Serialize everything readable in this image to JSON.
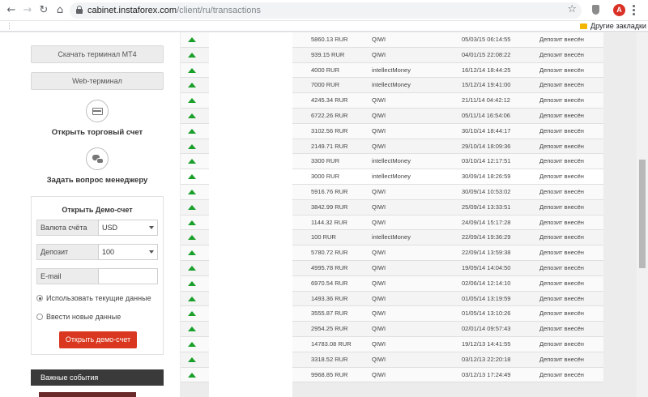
{
  "browser": {
    "url_host": "cabinet.instaforex.com",
    "url_path": "/client/ru/transactions",
    "avatar_letter": "A",
    "bookmarks_label": "Другие закладки"
  },
  "sidebar": {
    "download_terminal": "Скачать терминал MT4",
    "web_terminal": "Web-терминал",
    "open_account": "Открыть торговый счет",
    "ask_manager": "Задать вопрос менеджеру"
  },
  "demo": {
    "title": "Открыть Демо-счет",
    "currency_label": "Валюта счёта",
    "currency_value": "USD",
    "deposit_label": "Депозит",
    "deposit_value": "100",
    "email_label": "E-mail",
    "email_value": "",
    "use_current": "Использовать текущие данные",
    "enter_new": "Ввести новые данные",
    "submit": "Открыть демо-счет"
  },
  "events": {
    "title": "Важные события"
  },
  "transactions": [
    {
      "amount": "5860.13 RUR",
      "system": "QIWI",
      "date": "05/03/15 06:14:55",
      "status": "Депозит внесён"
    },
    {
      "amount": "939.15 RUR",
      "system": "QIWI",
      "date": "04/01/15 22:08:22",
      "status": "Депозит внесён"
    },
    {
      "amount": "4000 RUR",
      "system": "intellectMoney",
      "date": "16/12/14 18:44:25",
      "status": "Депозит внесён"
    },
    {
      "amount": "7000 RUR",
      "system": "intellectMoney",
      "date": "15/12/14 19:41:00",
      "status": "Депозит внесён"
    },
    {
      "amount": "4245.34 RUR",
      "system": "QIWI",
      "date": "21/11/14 04:42:12",
      "status": "Депозит внесён"
    },
    {
      "amount": "6722.26 RUR",
      "system": "QIWI",
      "date": "05/11/14 16:54:06",
      "status": "Депозит внесён"
    },
    {
      "amount": "3102.56 RUR",
      "system": "QIWI",
      "date": "30/10/14 18:44:17",
      "status": "Депозит внесён"
    },
    {
      "amount": "2149.71 RUR",
      "system": "QIWI",
      "date": "29/10/14 18:09:36",
      "status": "Депозит внесён"
    },
    {
      "amount": "3300 RUR",
      "system": "intellectMoney",
      "date": "03/10/14 12:17:51",
      "status": "Депозит внесён"
    },
    {
      "amount": "3000 RUR",
      "system": "intellectMoney",
      "date": "30/09/14 18:26:59",
      "status": "Депозит внесён"
    },
    {
      "amount": "5916.76 RUR",
      "system": "QIWI",
      "date": "30/09/14 10:53:02",
      "status": "Депозит внесён"
    },
    {
      "amount": "3842.99 RUR",
      "system": "QIWI",
      "date": "25/09/14 13:33:51",
      "status": "Депозит внесён"
    },
    {
      "amount": "1144.32 RUR",
      "system": "QIWI",
      "date": "24/09/14 15:17:28",
      "status": "Депозит внесён"
    },
    {
      "amount": "100 RUR",
      "system": "intellectMoney",
      "date": "22/09/14 19:36:29",
      "status": "Депозит внесён"
    },
    {
      "amount": "5780.72 RUR",
      "system": "QIWI",
      "date": "22/09/14 13:59:38",
      "status": "Депозит внесён"
    },
    {
      "amount": "4995.78 RUR",
      "system": "QIWI",
      "date": "19/09/14 14:04:50",
      "status": "Депозит внесён"
    },
    {
      "amount": "6970.54 RUR",
      "system": "QIWI",
      "date": "02/06/14 12:14:10",
      "status": "Депозит внесён"
    },
    {
      "amount": "1493.36 RUR",
      "system": "QIWI",
      "date": "01/05/14 13:19:59",
      "status": "Депозит внесён"
    },
    {
      "amount": "3555.87 RUR",
      "system": "QIWI",
      "date": "01/05/14 13:10:26",
      "status": "Депозит внесён"
    },
    {
      "amount": "2954.25 RUR",
      "system": "QIWI",
      "date": "02/01/14 09:57:43",
      "status": "Депозит внесён"
    },
    {
      "amount": "14783.08 RUR",
      "system": "QIWI",
      "date": "19/12/13 14:41:55",
      "status": "Депозит внесён"
    },
    {
      "amount": "3318.52 RUR",
      "system": "QIWI",
      "date": "03/12/13 22:20:18",
      "status": "Депозит внесён"
    },
    {
      "amount": "9968.85 RUR",
      "system": "QIWI",
      "date": "03/12/13 17:24:49",
      "status": "Депозит внесён"
    }
  ]
}
